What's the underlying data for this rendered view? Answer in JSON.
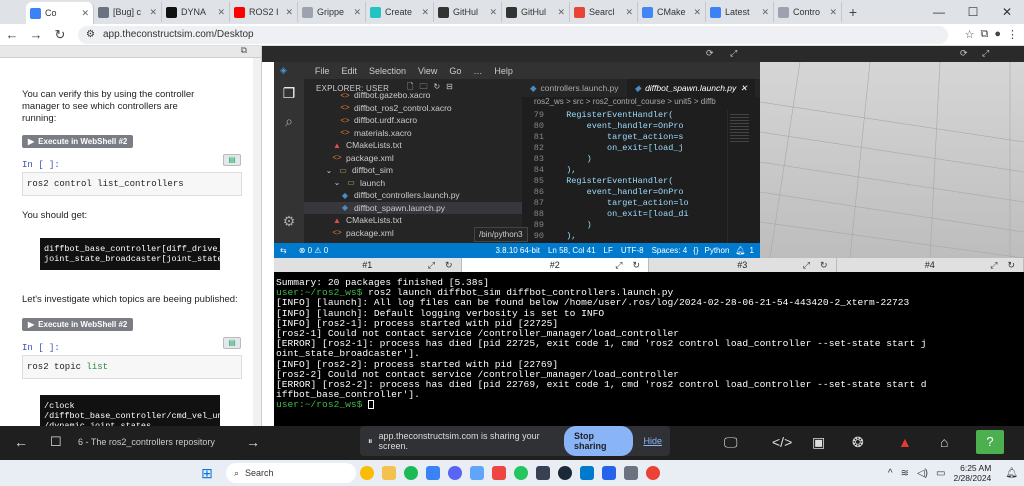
{
  "browser": {
    "tabs": [
      {
        "label": "Co",
        "icon": "theconstruct-icon",
        "color": "#3b82f6",
        "active": true
      },
      {
        "label": "[Bug] c",
        "icon": "rocket-icon",
        "color": "#6b7280"
      },
      {
        "label": "DYNA",
        "icon": "r-logo-icon",
        "color": "#111111"
      },
      {
        "label": "ROS2 I",
        "icon": "youtube-icon",
        "color": "#ff0000"
      },
      {
        "label": "Grippe",
        "icon": "grid-icon",
        "color": "#9ca3af"
      },
      {
        "label": "Create",
        "icon": "canva-icon",
        "color": "#22c3c3"
      },
      {
        "label": "GitHul",
        "icon": "github-icon",
        "color": "#333333"
      },
      {
        "label": "GitHul",
        "icon": "github-icon",
        "color": "#333333"
      },
      {
        "label": "Searcl",
        "icon": "gmail-icon",
        "color": "#ea4335"
      },
      {
        "label": "CMake",
        "icon": "google-g-icon",
        "color": "#4285f4"
      },
      {
        "label": "Latest",
        "icon": "theconstruct-icon",
        "color": "#3b82f6"
      },
      {
        "label": "Contro",
        "icon": "grid-icon",
        "color": "#9ca3af"
      }
    ],
    "url": "app.theconstructsim.com/Desktop"
  },
  "left_pane": {
    "intro": "You can verify this by using the controller manager to see which controllers are running:",
    "exec_label": "Execute in WebShell #2",
    "cell_label": "In [ ]:",
    "cmd1": "ros2 control list_controllers",
    "should_get": "You should get:",
    "out1_line1": "diffbot_base_controller[diff_drive_co",
    "out1_line2": "joint_state_broadcaster[joint_state_b",
    "topics_text": "Let's investigate which topics are beeing published:",
    "exec_label2": "Execute in WebShell #2",
    "cell_label2": "In [ ]:",
    "cmd2_a": "ros2 topic ",
    "cmd2_b": "list",
    "out2": [
      "/clock",
      "/diffbot_base_controller/cmd_vel_unst",
      "/dynamic_joint_states",
      "/joint_states"
    ]
  },
  "ide": {
    "menu": [
      "File",
      "Edit",
      "Selection",
      "View",
      "Go",
      "Help"
    ],
    "explorer_title": "EXPLORER: USER",
    "tree": [
      {
        "name": "diffbot.gazebo.xacro",
        "indent": 4,
        "icon": "xml-icon"
      },
      {
        "name": "diffbot_ros2_control.xacro",
        "indent": 4,
        "icon": "xml-icon"
      },
      {
        "name": "diffbot.urdf.xacro",
        "indent": 4,
        "icon": "xml-icon"
      },
      {
        "name": "materials.xacro",
        "indent": 4,
        "icon": "xml-icon"
      },
      {
        "name": "CMakeLists.txt",
        "indent": 3,
        "icon": "cmake-icon"
      },
      {
        "name": "package.xml",
        "indent": 3,
        "icon": "xml-icon"
      },
      {
        "name": "diffbot_sim",
        "indent": 2,
        "icon": "folder-icon",
        "folder": true
      },
      {
        "name": "launch",
        "indent": 3,
        "icon": "folder-icon",
        "folder": true
      },
      {
        "name": "diffbot_controllers.launch.py",
        "indent": 4,
        "icon": "python-icon"
      },
      {
        "name": "diffbot_spawn.launch.py",
        "indent": 4,
        "icon": "python-icon",
        "selected": true
      },
      {
        "name": "CMakeLists.txt",
        "indent": 3,
        "icon": "cmake-icon"
      },
      {
        "name": "package.xml",
        "indent": 3,
        "icon": "xml-icon"
      }
    ],
    "editor_tabs": [
      {
        "label": "controllers.launch.py",
        "active": false
      },
      {
        "label": "diffbot_spawn.launch.py",
        "active": true
      }
    ],
    "breadcrumb": "ros2_ws  >  src  >  ros2_control_course  >  unit5  >  diffb",
    "code": [
      {
        "n": "79",
        "t": "  RegisterEventHandler("
      },
      {
        "n": "80",
        "t": "      event_handler=OnPro"
      },
      {
        "n": "81",
        "t": "          target_action=s"
      },
      {
        "n": "82",
        "t": "          on_exit=[load_j"
      },
      {
        "n": "83",
        "t": "      )"
      },
      {
        "n": "84",
        "t": "  ),"
      },
      {
        "n": "85",
        "t": "  RegisterEventHandler("
      },
      {
        "n": "86",
        "t": "      event_handler=OnPro"
      },
      {
        "n": "87",
        "t": "          target_action=lo"
      },
      {
        "n": "88",
        "t": "          on_exit=[load_di"
      },
      {
        "n": "89",
        "t": "      )"
      },
      {
        "n": "90",
        "t": "  ),"
      },
      {
        "n": "91",
        "t": "  gazebo,"
      },
      {
        "n": "92",
        "t": "  node_robot_state_pu"
      }
    ],
    "status": {
      "problems": "⊗ 0 ⚠ 0",
      "python_ver": "3.8.10 64-bit",
      "position": "Ln 58, Col 41",
      "eol": "LF",
      "encoding": "UTF-8",
      "spaces": "Spaces: 4",
      "language": "Python",
      "notif": "1"
    },
    "tooltip": "/bin/python3"
  },
  "terminal": {
    "tabs": [
      "#1",
      "#2",
      "#3",
      "#4"
    ],
    "active_tab": 1,
    "line0": "Summary: 20 packages finished [5.38s]",
    "prompt": "user:~/ros2_ws$",
    "cmd": " ros2 launch diffbot_sim diffbot_controllers.launch.py",
    "lines": [
      "[INFO] [launch]: All log files can be found below /home/user/.ros/log/2024-02-28-06-21-54-443420-2_xterm-22723",
      "[INFO] [launch]: Default logging verbosity is set to INFO",
      "[INFO] [ros2-1]: process started with pid [22725]",
      "[ros2-1] Could not contact service /controller_manager/load_controller",
      "[ERROR] [ros2-1]: process has died [pid 22725, exit code 1, cmd 'ros2 control load_controller --set-state start j",
      "oint_state_broadcaster'].",
      "[INFO] [ros2-2]: process started with pid [22769]",
      "[ros2-2] Could not contact service /controller_manager/load_controller",
      "[ERROR] [ros2-2]: process has died [pid 22769, exit code 1, cmd 'ros2 control load_controller --set-state start d",
      "iffbot_base_controller']."
    ],
    "final_prompt": "user:~/ros2_ws$"
  },
  "bottom_nav": {
    "page_title": "6 - The ros2_controllers repository"
  },
  "share": {
    "message": "app.theconstructsim.com is sharing your screen.",
    "stop": "Stop sharing",
    "hide": "Hide"
  },
  "taskbar": {
    "search": "Search",
    "time": "6:25 AM",
    "date": "2/28/2024"
  },
  "colors": {
    "vscode_status": "#007acc",
    "terminal_prompt": "#3fb950",
    "stop_sharing": "#8ab4f8",
    "help_green": "#4caf50"
  }
}
